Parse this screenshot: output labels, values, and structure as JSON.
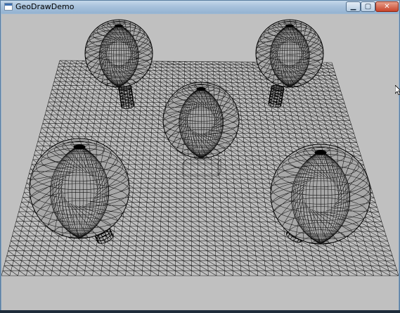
{
  "window": {
    "title": "GeoDrawDemo",
    "icon": "app-window-icon",
    "controls": {
      "minimize": "▁",
      "maximize": "▢",
      "close": "✕"
    }
  },
  "scene": {
    "background_color": "#c0c0c0",
    "wire_color": "#000000",
    "objects": [
      "ground-grid",
      "sphere",
      "sphere",
      "sphere",
      "sphere",
      "sphere",
      "cylinder",
      "cylinder",
      "cylinder",
      "cylinder",
      "wire-box"
    ]
  }
}
